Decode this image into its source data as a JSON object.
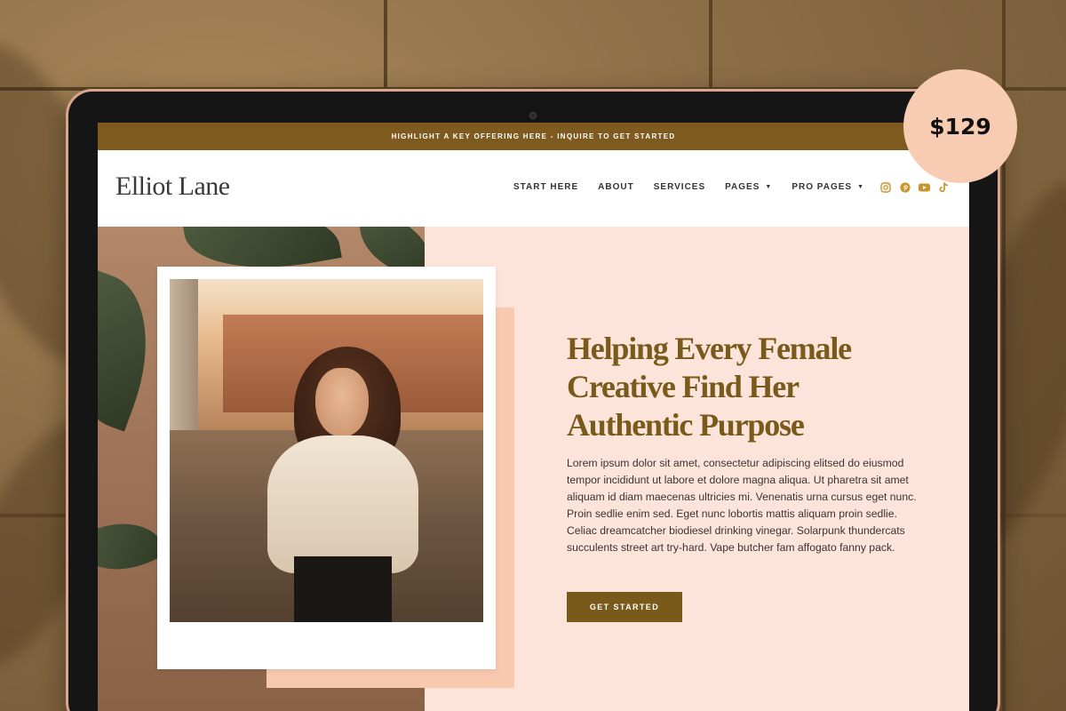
{
  "promo_bar": {
    "text": "HIGHLIGHT A KEY OFFERING HERE - INQUIRE TO GET STARTED"
  },
  "header": {
    "logo": "Elliot Lane",
    "menu": [
      {
        "label": "START HERE",
        "dropdown": false
      },
      {
        "label": "ABOUT",
        "dropdown": false
      },
      {
        "label": "SERVICES",
        "dropdown": false
      },
      {
        "label": "PAGES",
        "dropdown": true
      },
      {
        "label": "PRO PAGES",
        "dropdown": true
      }
    ],
    "social_icons": [
      "instagram-icon",
      "pinterest-icon",
      "youtube-icon",
      "tiktok-icon"
    ]
  },
  "hero": {
    "headline": "Helping Every Female Creative Find Her Authentic Purpose",
    "body": "Lorem ipsum dolor sit amet, consectetur adipiscing elitsed do eiusmod tempor incididunt ut labore et dolore magna aliqua. Ut pharetra sit amet aliquam id diam maecenas ultricies mi. Venenatis urna cursus eget nunc. Proin sedlie enim sed. Eget nunc lobortis mattis aliquam proin sedlie. Celiac dreamcatcher biodiesel drinking vinegar. Solarpunk thundercats succulents street art try-hard. Vape butcher fam affogato fanny pack.",
    "cta_label": "GET STARTED"
  },
  "price_badge": {
    "price": "$129"
  },
  "colors": {
    "accent_brown": "#7a5a1a",
    "promo_bar_bg": "#7e5a1f",
    "hero_bg": "#fde4da",
    "peach": "#f9c9af",
    "social_icon": "#c9962c"
  }
}
